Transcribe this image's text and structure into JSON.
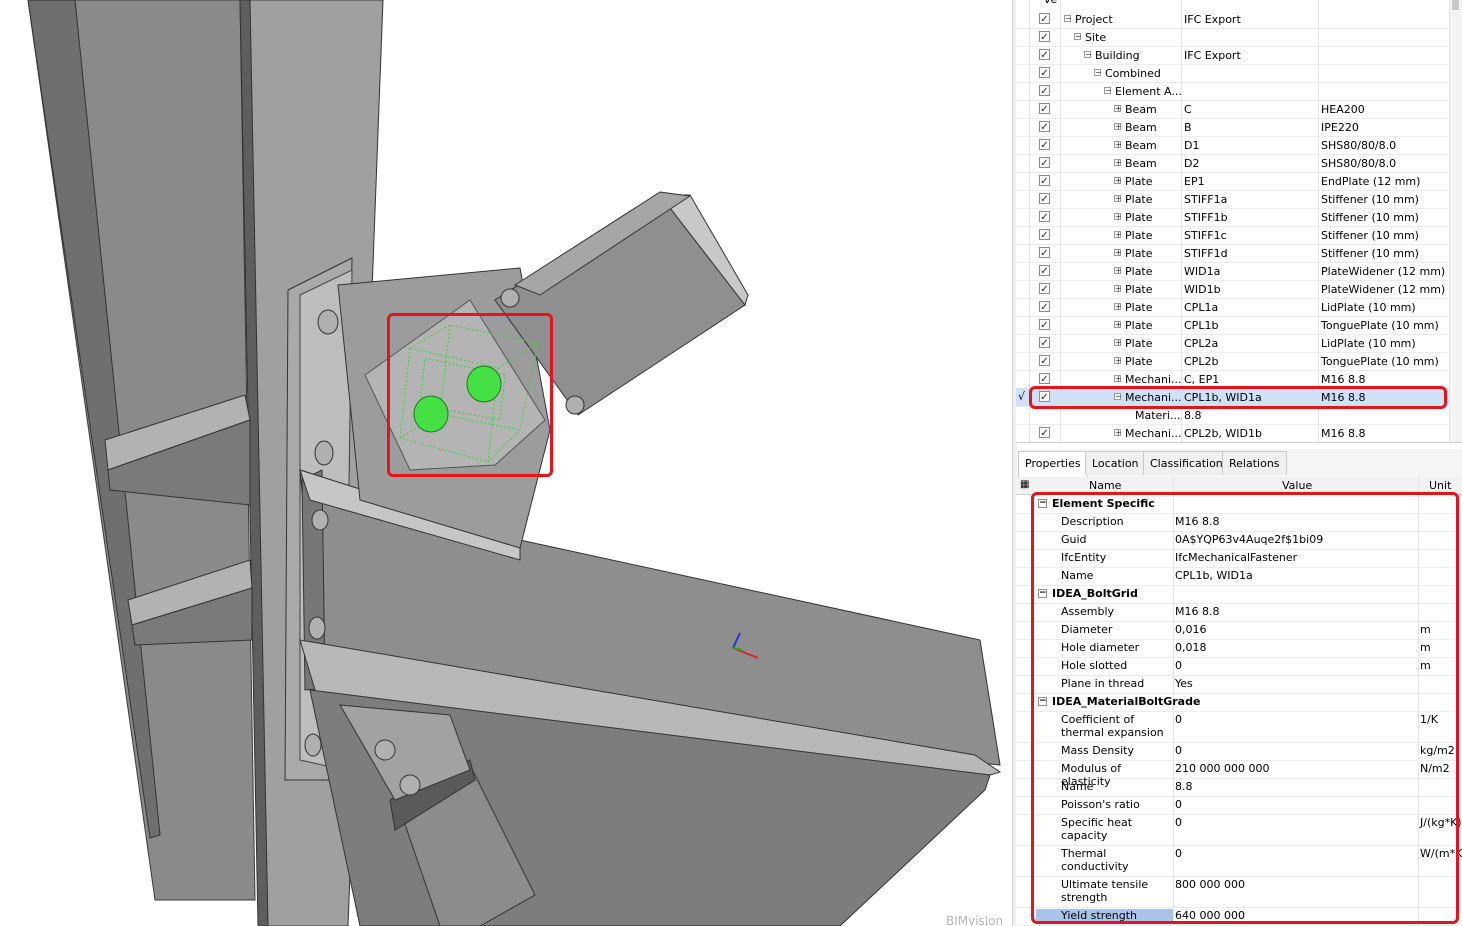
{
  "viewer": {
    "watermark": "BIMvision"
  },
  "tree": {
    "header_fragment": "ve",
    "rows": [
      {
        "indent": 0,
        "expander": "−",
        "name": "Project",
        "col2": "IFC Export",
        "col3": ""
      },
      {
        "indent": 1,
        "expander": "−",
        "name": "Site",
        "col2": "",
        "col3": ""
      },
      {
        "indent": 2,
        "expander": "−",
        "name": "Building",
        "col2": "IFC Export",
        "col3": ""
      },
      {
        "indent": 3,
        "expander": "−",
        "name": "Combined",
        "col2": "",
        "col3": ""
      },
      {
        "indent": 4,
        "expander": "−",
        "name": "Element A...",
        "col2": "",
        "col3": ""
      },
      {
        "indent": 5,
        "expander": "+",
        "name": "Beam",
        "col2": "C",
        "col3": "HEA200"
      },
      {
        "indent": 5,
        "expander": "+",
        "name": "Beam",
        "col2": "B",
        "col3": "IPE220"
      },
      {
        "indent": 5,
        "expander": "+",
        "name": "Beam",
        "col2": "D1",
        "col3": "SHS80/80/8.0"
      },
      {
        "indent": 5,
        "expander": "+",
        "name": "Beam",
        "col2": "D2",
        "col3": "SHS80/80/8.0"
      },
      {
        "indent": 5,
        "expander": "+",
        "name": "Plate",
        "col2": "EP1",
        "col3": "EndPlate (12 mm)"
      },
      {
        "indent": 5,
        "expander": "+",
        "name": "Plate",
        "col2": "STIFF1a",
        "col3": "Stiffener (10 mm)"
      },
      {
        "indent": 5,
        "expander": "+",
        "name": "Plate",
        "col2": "STIFF1b",
        "col3": "Stiffener (10 mm)"
      },
      {
        "indent": 5,
        "expander": "+",
        "name": "Plate",
        "col2": "STIFF1c",
        "col3": "Stiffener (10 mm)"
      },
      {
        "indent": 5,
        "expander": "+",
        "name": "Plate",
        "col2": "STIFF1d",
        "col3": "Stiffener (10 mm)"
      },
      {
        "indent": 5,
        "expander": "+",
        "name": "Plate",
        "col2": "WID1a",
        "col3": "PlateWidener (12 mm)"
      },
      {
        "indent": 5,
        "expander": "+",
        "name": "Plate",
        "col2": "WID1b",
        "col3": "PlateWidener (12 mm)"
      },
      {
        "indent": 5,
        "expander": "+",
        "name": "Plate",
        "col2": "CPL1a",
        "col3": "LidPlate (10 mm)"
      },
      {
        "indent": 5,
        "expander": "+",
        "name": "Plate",
        "col2": "CPL1b",
        "col3": "TonguePlate (10 mm)"
      },
      {
        "indent": 5,
        "expander": "+",
        "name": "Plate",
        "col2": "CPL2a",
        "col3": "LidPlate (10 mm)"
      },
      {
        "indent": 5,
        "expander": "+",
        "name": "Plate",
        "col2": "CPL2b",
        "col3": "TonguePlate (10 mm)"
      },
      {
        "indent": 5,
        "expander": "+",
        "name": "Mechani...",
        "col2": "C, EP1",
        "col3": "M16 8.8"
      },
      {
        "indent": 5,
        "expander": "−",
        "name": "Mechani...",
        "col2": "CPL1b, WID1a",
        "col3": "M16 8.8",
        "selected": true,
        "mark": "√"
      },
      {
        "indent": 6,
        "expander": "",
        "name": "Materi...",
        "col2": "8.8",
        "col3": "",
        "nocheck": true
      },
      {
        "indent": 5,
        "expander": "+",
        "name": "Mechani...",
        "col2": "CPL2b, WID1b",
        "col3": "M16 8.8"
      }
    ]
  },
  "tabs": [
    "Properties",
    "Location",
    "Classification",
    "Relations"
  ],
  "properties": {
    "header": {
      "name": "Name",
      "value": "Value",
      "unit": "Unit"
    },
    "groups": [
      {
        "title": "Element Specific",
        "items": [
          {
            "name": "Description",
            "value": "M16 8.8",
            "unit": ""
          },
          {
            "name": "Guid",
            "value": "0A$YQP63v4Auqe2f$1bi09",
            "unit": ""
          },
          {
            "name": "IfcEntity",
            "value": "IfcMechanicalFastener",
            "unit": ""
          },
          {
            "name": "Name",
            "value": "CPL1b, WID1a",
            "unit": ""
          }
        ]
      },
      {
        "title": "IDEA_BoltGrid",
        "items": [
          {
            "name": "Assembly",
            "value": "M16 8.8",
            "unit": ""
          },
          {
            "name": "Diameter",
            "value": "0,016",
            "unit": "m"
          },
          {
            "name": "Hole diameter",
            "value": "0,018",
            "unit": "m"
          },
          {
            "name": "Hole slotted",
            "value": "0",
            "unit": "m"
          },
          {
            "name": "Plane in thread",
            "value": "Yes",
            "unit": ""
          }
        ]
      },
      {
        "title": "IDEA_MaterialBoltGrade",
        "items": [
          {
            "name": "Coefficient of thermal expansion",
            "value": "0",
            "unit": "1/K",
            "tall": true
          },
          {
            "name": "Mass Density",
            "value": "0",
            "unit": "kg/m2"
          },
          {
            "name": "Modulus of elasticity",
            "value": "210 000 000 000",
            "unit": "N/m2"
          },
          {
            "name": "Name",
            "value": "8.8",
            "unit": ""
          },
          {
            "name": "Poisson's ratio",
            "value": "0",
            "unit": ""
          },
          {
            "name": "Specific heat capacity",
            "value": "0",
            "unit": "J/(kg*K)",
            "tall": true
          },
          {
            "name": "Thermal conductivity",
            "value": "0",
            "unit": "W/(m*K)",
            "tall": true
          },
          {
            "name": "Ultimate tensile strength",
            "value": "800 000 000",
            "unit": "",
            "tall": true
          },
          {
            "name": "Yield strength",
            "value": "640 000 000",
            "unit": "",
            "selected": true
          }
        ]
      }
    ]
  }
}
